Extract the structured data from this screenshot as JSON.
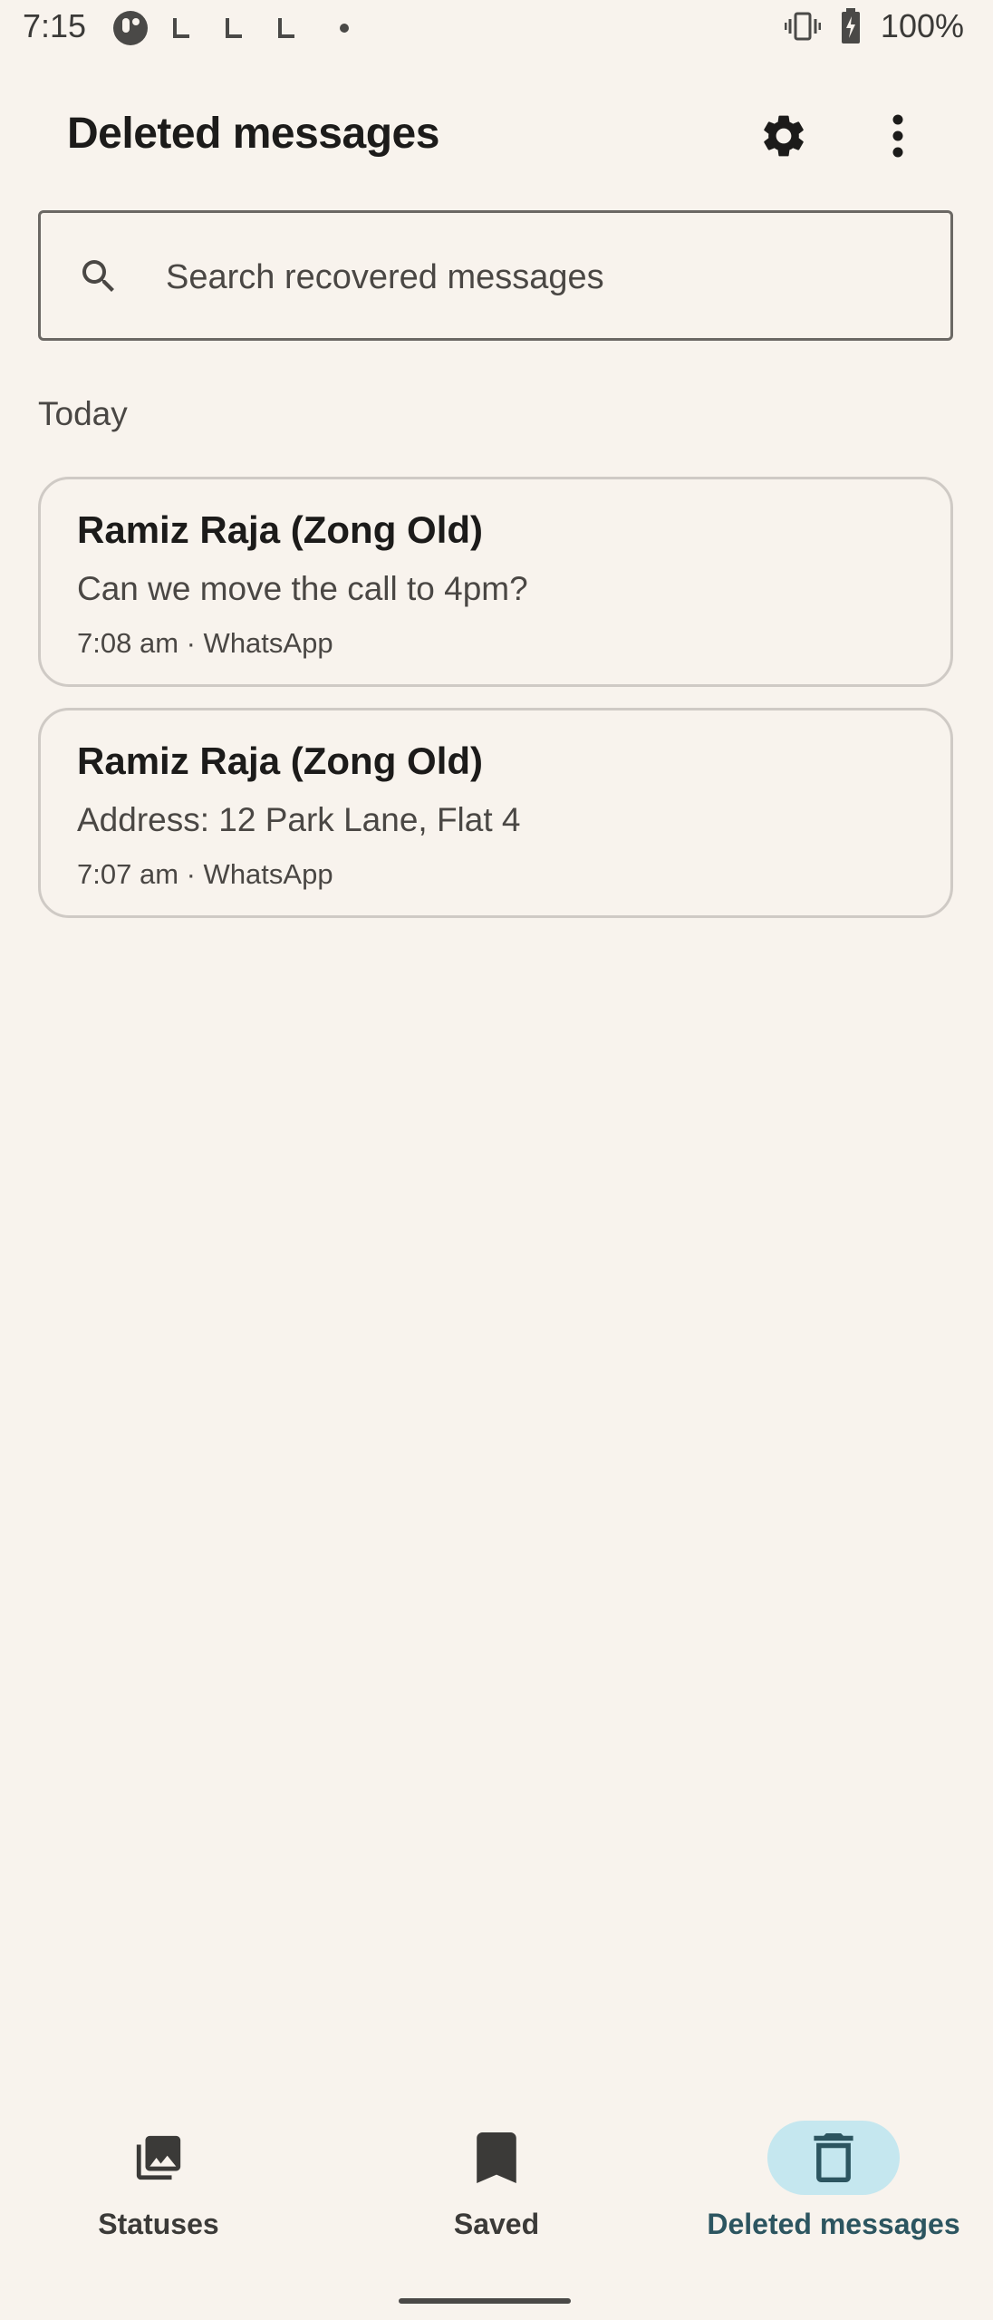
{
  "status_bar": {
    "time": "7:15",
    "battery": "100%",
    "icons": [
      "app-notification-icon",
      "missed-call-icon",
      "missed-call-icon",
      "missed-call-icon",
      "dot-icon",
      "vibrate-icon",
      "battery-charging-icon"
    ]
  },
  "header": {
    "title": "Deleted messages",
    "settings_icon": "gear-icon",
    "more_icon": "more-vert-icon"
  },
  "search": {
    "placeholder": "Search recovered messages",
    "value": ""
  },
  "sections": [
    {
      "label": "Today",
      "messages": [
        {
          "sender": "Ramiz Raja (Zong Old)",
          "text": "Can we move the call to 4pm?",
          "meta": "7:08 am · WhatsApp"
        },
        {
          "sender": "Ramiz Raja (Zong Old)",
          "text": "Address: 12 Park Lane, Flat 4",
          "meta": "7:07 am · WhatsApp"
        }
      ]
    }
  ],
  "bottom_nav": {
    "items": [
      {
        "label": "Statuses",
        "icon": "gallery-icon",
        "selected": false
      },
      {
        "label": "Saved",
        "icon": "bookmark-icon",
        "selected": false
      },
      {
        "label": "Deleted messages",
        "icon": "trash-icon",
        "selected": true
      }
    ]
  },
  "colors": {
    "background": "#f8f3ed",
    "selected_pill": "#c5e7ef",
    "selected_label": "#2c5560"
  }
}
